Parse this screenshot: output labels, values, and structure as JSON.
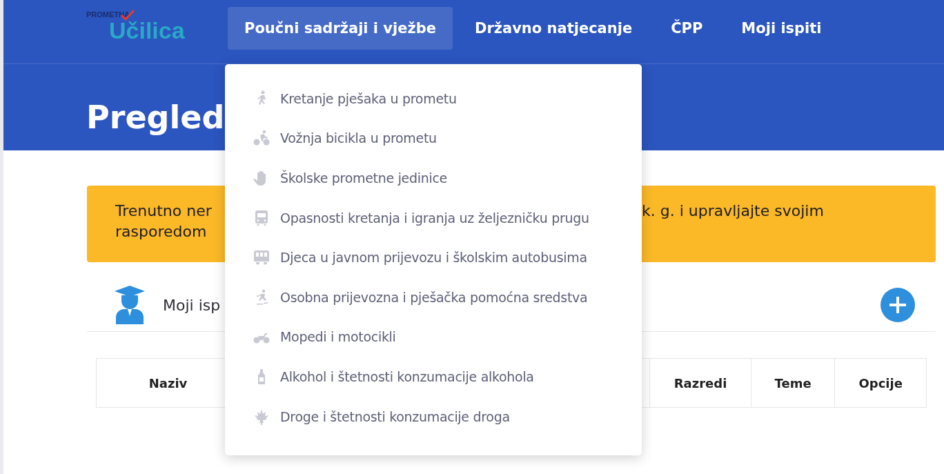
{
  "header": {
    "logo": {
      "top": "PROMETNA",
      "name": "Učilica"
    },
    "nav": [
      {
        "label": "Poučni sadržaji i vježbe",
        "selected": true
      },
      {
        "label": "Državno natjecanje",
        "selected": false
      },
      {
        "label": "ČPP",
        "selected": false
      },
      {
        "label": "Moji ispiti",
        "selected": false
      }
    ]
  },
  "page_title": "Pregled",
  "notice": {
    "left_lines": [
      "Trenutno ner",
      "rasporedom"
    ],
    "right": "k. g. i upravljajte svojim"
  },
  "section": {
    "title": "Moji isp"
  },
  "table": {
    "columns": [
      "Naziv",
      "Razredi",
      "Teme",
      "Opcije"
    ]
  },
  "dropdown": {
    "items": [
      {
        "label": "Kretanje pješaka u prometu",
        "kind": "walk"
      },
      {
        "label": "Vožnja bicikla u prometu",
        "kind": "bike"
      },
      {
        "label": "Školske prometne jedinice",
        "kind": "hand"
      },
      {
        "label": "Opasnosti kretanja i igranja uz željezničku prugu",
        "kind": "train"
      },
      {
        "label": "Djeca u javnom prijevozu i školskim autobusima",
        "kind": "bus"
      },
      {
        "label": "Osobna prijevozna i pješačka pomoćna sredstva",
        "kind": "skate"
      },
      {
        "label": "Mopedi i motocikli",
        "kind": "moto"
      },
      {
        "label": "Alkohol i štetnosti konzumacije alkohola",
        "kind": "bottle"
      },
      {
        "label": "Droge i štetnosti konzumacije droga",
        "kind": "leaf"
      }
    ]
  }
}
